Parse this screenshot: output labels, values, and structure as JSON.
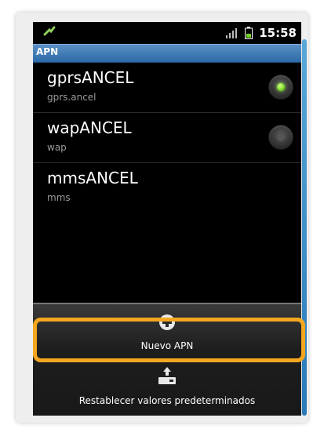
{
  "statusbar": {
    "time": "15:58"
  },
  "header": {
    "title": "APN"
  },
  "apns": [
    {
      "name": "gprsANCEL",
      "apn": "gprs.ancel",
      "selected": true
    },
    {
      "name": "wapANCEL",
      "apn": "wap",
      "selected": false
    },
    {
      "name": "mmsANCEL",
      "apn": "mms",
      "selected": null
    }
  ],
  "menu": {
    "new_apn_label": "Nuevo APN",
    "reset_label": "Restablecer valores predeterminados"
  },
  "colors": {
    "highlight": "#f4a71e",
    "radio_on": "#6ccf1a",
    "title_bar": "#3d7ab8"
  }
}
